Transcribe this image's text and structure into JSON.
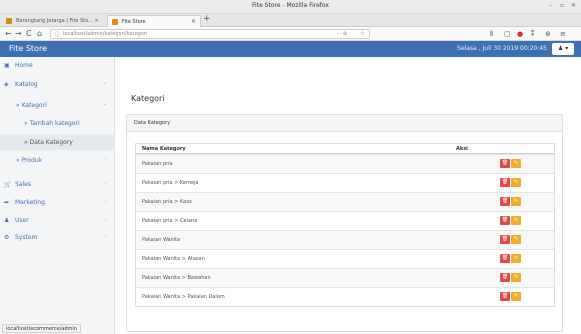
{
  "window": {
    "title": "Fite Store - Mozilla Firefox",
    "controls": [
      "–",
      "▫",
      "✕"
    ]
  },
  "tabs": [
    {
      "label": "Barangtang Jetarga | Fite Sto... ✕",
      "active": false,
      "favicon_color": "#d08a20"
    },
    {
      "label": "Fite Store",
      "active": true,
      "favicon_color": "#e08a20"
    }
  ],
  "new_tab_label": "+",
  "navbar": {
    "back": "←",
    "forward": "→",
    "reload": "C",
    "home": "⌂",
    "info_icon": "ⓘ",
    "url": "localhost/admin/kategori/kategori",
    "more": "··· ⊘",
    "star": "☆",
    "toolbar_icons": [
      "⫴",
      "▢",
      "●",
      "⁑",
      "⊛",
      "≡"
    ]
  },
  "app": {
    "brand": "Fite Store",
    "datetime": "Selasa , Juli 30 2019 00:20:45",
    "user_menu": "♟ ▾"
  },
  "sidebar": {
    "items": [
      {
        "label": "Home",
        "icon": "▣",
        "chevron": ""
      },
      {
        "label": "Katalog",
        "icon": "◈",
        "chevron": "⌄"
      },
      {
        "label": "» Kategori",
        "icon": "",
        "chevron": "⌄"
      },
      {
        "label": "» Tambah kategori",
        "icon": "",
        "chevron": ""
      },
      {
        "label": "» Data Kategory",
        "icon": "",
        "chevron": ""
      },
      {
        "label": "» Produk",
        "icon": "",
        "chevron": "‹"
      },
      {
        "label": "Sales",
        "icon": "🛒",
        "chevron": "‹"
      },
      {
        "label": "Marketing",
        "icon": "➦",
        "chevron": "‹"
      },
      {
        "label": "User",
        "icon": "♟",
        "chevron": "‹"
      },
      {
        "label": "System",
        "icon": "⚙",
        "chevron": "‹"
      }
    ]
  },
  "status_bar": "localhost/ecommerce/admin",
  "main": {
    "page_title": "Kategori",
    "panel_title": "Data Kategory",
    "table": {
      "headers": [
        "Nama Kategory",
        "Aksi"
      ],
      "rows": [
        "Pakaian pria",
        "Pakaian pria > Kemeja",
        "Pakaian pria > Kaos",
        "Pakaian pria > Celana",
        "Pakaian Wanita",
        "Pakaian Wanita > Atasan",
        "Pakaian Wanita > Bawahan",
        "Pakaian Wanita > Pakaian Dalam"
      ],
      "delete_icon": "🗑",
      "edit_icon": "✎"
    }
  },
  "colors": {
    "header_blue": "#3e71b0",
    "delete_red": "#e04a4a",
    "edit_orange": "#f0ad2b"
  }
}
